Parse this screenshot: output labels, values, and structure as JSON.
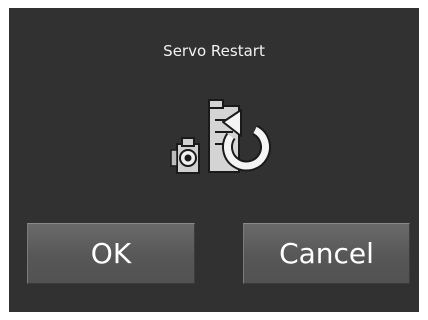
{
  "dialog": {
    "title": "Servo Restart",
    "icon": "servo-restart-icon",
    "ok_label": "OK",
    "cancel_label": "Cancel"
  },
  "colors": {
    "dialog_background": "#313131",
    "button_background": "#5a5a5a",
    "text": "#ffffff"
  }
}
